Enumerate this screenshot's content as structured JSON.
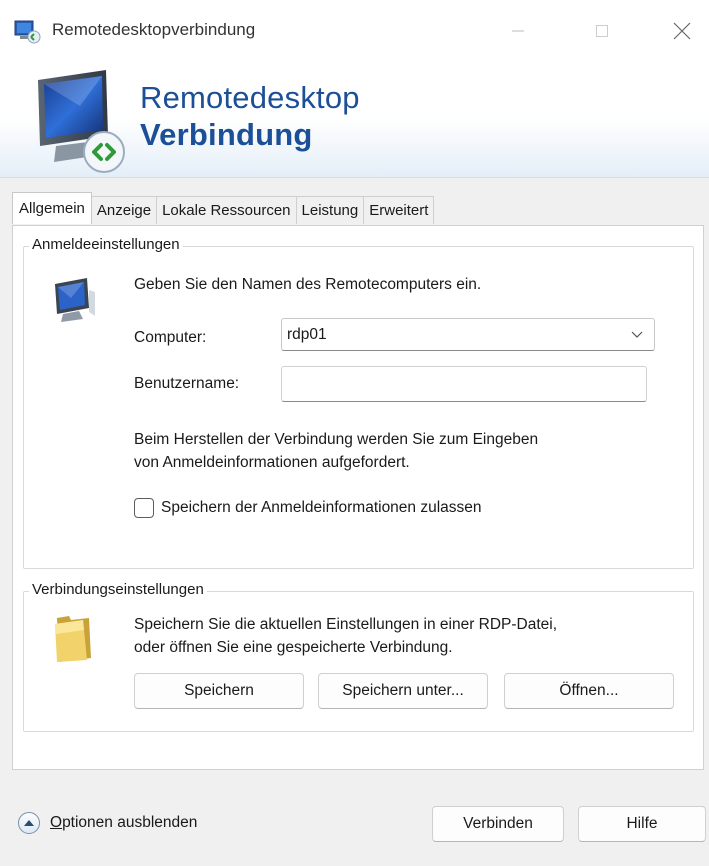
{
  "window": {
    "title": "Remotedesktopverbindung",
    "icons": [
      "remote-desktop-icon",
      "minimize-icon",
      "maximize-icon",
      "close-icon"
    ]
  },
  "banner": {
    "line1": "Remotedesktop",
    "line2": "Verbindung",
    "icon": "remote-desktop-monitor-icon"
  },
  "tabs": [
    {
      "label": "Allgemein",
      "active": true
    },
    {
      "label": "Anzeige",
      "active": false
    },
    {
      "label": "Lokale Ressourcen",
      "active": false
    },
    {
      "label": "Leistung",
      "active": false
    },
    {
      "label": "Erweitert",
      "active": false
    }
  ],
  "logon": {
    "legend": "Anmeldeeinstellungen",
    "hint": "Geben Sie den Namen des Remotecomputers ein.",
    "computer_label": "Computer:",
    "computer_value": "rdp01",
    "username_label": "Benutzername:",
    "username_value": "",
    "info_line1": "Beim Herstellen der Verbindung werden Sie zum Eingeben",
    "info_line2": "von Anmeldeinformationen aufgefordert.",
    "save_credentials_label": "Speichern der Anmeldeinformationen zulassen",
    "save_credentials_checked": false
  },
  "connection": {
    "legend": "Verbindungseinstellungen",
    "text_line1": "Speichern Sie die aktuellen Einstellungen in einer RDP-Datei,",
    "text_line2": "oder öffnen Sie eine gespeicherte Verbindung.",
    "save_label": "Speichern",
    "save_as_label": "Speichern unter...",
    "open_label": "Öffnen..."
  },
  "footer": {
    "options_first_letter": "O",
    "options_rest": "ptionen ausblenden",
    "connect_label": "Verbinden",
    "help_label": "Hilfe"
  },
  "colors": {
    "banner_text": "#1b4f97",
    "background": "#f0f0f0",
    "panel": "#ffffff"
  }
}
